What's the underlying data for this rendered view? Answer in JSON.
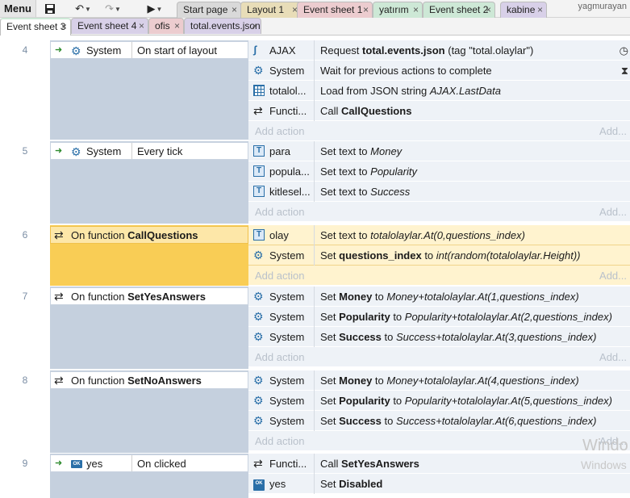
{
  "toolbar": {
    "menu_label": "Menu",
    "user": "yagmurayan"
  },
  "tabs_row1": [
    {
      "label": "Start page",
      "color": "#d9d9d9"
    },
    {
      "label": "Layout 1",
      "color": "#e8ddb8"
    },
    {
      "label": "Event sheet 1",
      "color": "#eccccf"
    },
    {
      "label": "yatırım",
      "color": "#cde8d6"
    },
    {
      "label": "Event sheet 2",
      "color": "#cde8d6"
    },
    {
      "label": "kabine",
      "color": "#d8d0e8"
    }
  ],
  "tabs_row2": [
    {
      "label": "Event sheet 3",
      "color": "#cde8d6",
      "active": true
    },
    {
      "label": "Event sheet 4",
      "color": "#d8d0e8"
    },
    {
      "label": "ofis",
      "color": "#eccccf"
    },
    {
      "label": "total.events.json",
      "color": "#d8d0e8"
    }
  ],
  "events": [
    {
      "number": "4",
      "condition": {
        "object": "System",
        "text": "On start of layout"
      },
      "actions": [
        {
          "icon": "ajax-icon",
          "object": "AJAX",
          "pre": "Request ",
          "bold": "total.events.json",
          "post": " (tag \"total.olaylar\")",
          "end_icon": "timer-icon"
        },
        {
          "icon": "gear-icon",
          "object": "System",
          "pre": "Wait for previous actions to complete",
          "end_icon": "wait-icon"
        },
        {
          "icon": "json-icon",
          "object": "totalol...",
          "pre": "Load from JSON string ",
          "italic": "AJAX.LastData"
        },
        {
          "icon": "function-icon",
          "object": "Functi...",
          "pre": "Call ",
          "bold": "CallQuestions"
        }
      ],
      "add_action": "Add action",
      "add_more": "Add..."
    },
    {
      "number": "5",
      "condition": {
        "object": "System",
        "text": "Every tick"
      },
      "actions": [
        {
          "icon": "text-icon",
          "object": "para",
          "pre": "Set text to ",
          "italic": "Money"
        },
        {
          "icon": "text-icon",
          "object": "popula...",
          "pre": "Set text to ",
          "italic": "Popularity"
        },
        {
          "icon": "text-icon",
          "object": "kitlesel...",
          "pre": "Set text to ",
          "italic": "Success"
        }
      ],
      "add_action": "Add action",
      "add_more": "Add..."
    },
    {
      "number": "6",
      "function": {
        "pre": "On function ",
        "name": "CallQuestions"
      },
      "selected": true,
      "actions": [
        {
          "icon": "text-icon",
          "object": "olay",
          "pre": "Set text to ",
          "italic": "totalolaylar.At(0,questions_index)"
        },
        {
          "icon": "gear-icon",
          "object": "System",
          "pre": "Set ",
          "bold": "questions_index",
          "post": " to ",
          "italic": "int(random(totalolaylar.Height))"
        }
      ],
      "add_action": "Add action",
      "add_more": "Add..."
    },
    {
      "number": "7",
      "function": {
        "pre": "On function ",
        "name": "SetYesAnswers"
      },
      "actions": [
        {
          "icon": "gear-icon",
          "object": "System",
          "pre": "Set ",
          "bold": "Money",
          "post": " to ",
          "italic": "Money+totalolaylar.At(1,questions_index)"
        },
        {
          "icon": "gear-icon",
          "object": "System",
          "pre": "Set ",
          "bold": "Popularity",
          "post": " to ",
          "italic": "Popularity+totalolaylar.At(2,questions_index)"
        },
        {
          "icon": "gear-icon",
          "object": "System",
          "pre": "Set ",
          "bold": "Success",
          "post": " to ",
          "italic": "Success+totalolaylar.At(3,questions_index)"
        }
      ],
      "add_action": "Add action",
      "add_more": "Add..."
    },
    {
      "number": "8",
      "function": {
        "pre": "On function ",
        "name": "SetNoAnswers"
      },
      "actions": [
        {
          "icon": "gear-icon",
          "object": "System",
          "pre": "Set ",
          "bold": "Money",
          "post": " to ",
          "italic": "Money+totalolaylar.At(4,questions_index)"
        },
        {
          "icon": "gear-icon",
          "object": "System",
          "pre": "Set ",
          "bold": "Popularity",
          "post": " to ",
          "italic": "Popularity+totalolaylar.At(5,questions_index)"
        },
        {
          "icon": "gear-icon",
          "object": "System",
          "pre": "Set ",
          "bold": "Success",
          "post": " to ",
          "italic": "Success+totalolaylar.At(6,questions_index)"
        }
      ],
      "add_action": "Add action",
      "add_more": "Add..."
    },
    {
      "number": "9",
      "condition": {
        "object": "yes",
        "text": "On clicked",
        "icon": "button-icon"
      },
      "actions": [
        {
          "icon": "function-icon",
          "object": "Functi...",
          "pre": "Call ",
          "bold": "SetYesAnswers"
        },
        {
          "icon": "button-icon",
          "object": "yes",
          "pre": "Set ",
          "bold": "Disabled"
        }
      ]
    }
  ],
  "watermark": {
    "line1": "Windo",
    "line2": "Windows"
  }
}
